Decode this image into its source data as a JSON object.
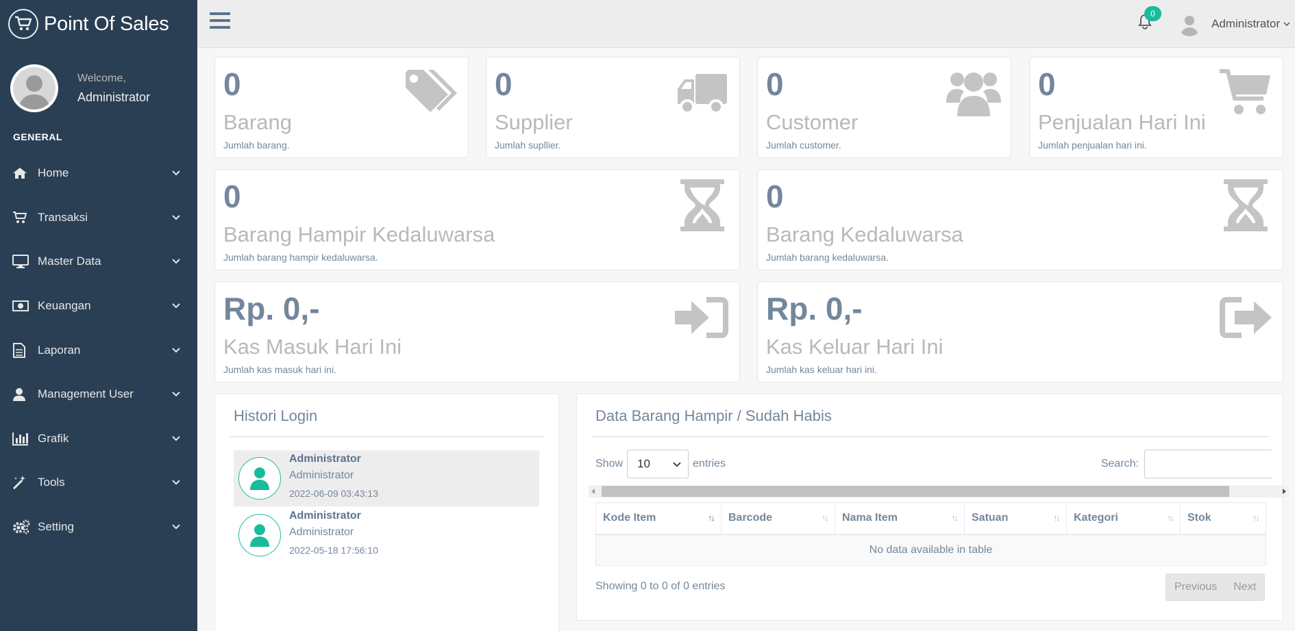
{
  "app": {
    "brand": "Point Of Sales"
  },
  "sidebar": {
    "welcome_label": "Welcome,",
    "user_name": "Administrator",
    "section": "GENERAL",
    "items": [
      {
        "label": "Home",
        "icon": "home-icon"
      },
      {
        "label": "Transaksi",
        "icon": "cart-icon"
      },
      {
        "label": "Master Data",
        "icon": "desktop-icon"
      },
      {
        "label": "Keuangan",
        "icon": "money-icon"
      },
      {
        "label": "Laporan",
        "icon": "file-icon"
      },
      {
        "label": "Management User",
        "icon": "user-icon"
      },
      {
        "label": "Grafik",
        "icon": "bar-chart-icon"
      },
      {
        "label": "Tools",
        "icon": "magic-wand-icon"
      },
      {
        "label": "Setting",
        "icon": "cogs-icon"
      }
    ]
  },
  "topbar": {
    "notif_count": "0",
    "user_name": "Administrator"
  },
  "stats": [
    {
      "count": "0",
      "label": "Barang",
      "desc": "Jumlah barang.",
      "icon": "tags-icon"
    },
    {
      "count": "0",
      "label": "Supplier",
      "desc": "Jumlah supllier.",
      "icon": "truck-icon"
    },
    {
      "count": "0",
      "label": "Customer",
      "desc": "Jumlah customer.",
      "icon": "users-icon"
    },
    {
      "count": "0",
      "label": "Penjualan Hari Ini",
      "desc": "Jumlah penjualan hari ini.",
      "icon": "cart-icon"
    },
    {
      "count": "0",
      "label": "Barang Hampir Kedaluwarsa",
      "desc": "Jumlah barang hampir kedaluwarsa.",
      "icon": "hourglass-icon"
    },
    {
      "count": "0",
      "label": "Barang Kedaluwarsa",
      "desc": "Jumlah barang kedaluwarsa.",
      "icon": "hourglass-icon"
    },
    {
      "count": "Rp. 0,-",
      "label": "Kas Masuk Hari Ini",
      "desc": "Jumlah kas masuk hari ini.",
      "icon": "sign-in-icon"
    },
    {
      "count": "Rp. 0,-",
      "label": "Kas Keluar Hari Ini",
      "desc": "Jumlah kas keluar hari ini.",
      "icon": "sign-out-icon"
    }
  ],
  "login_history": {
    "title": "Histori Login",
    "entries": [
      {
        "name": "Administrator",
        "role": "Administrator",
        "time": "2022-06-09 03:43:13"
      },
      {
        "name": "Administrator",
        "role": "Administrator",
        "time": "2022-05-18 17:56:10"
      }
    ]
  },
  "stock_table": {
    "title": "Data Barang Hampir / Sudah Habis",
    "show_label": "Show",
    "page_size": "10",
    "entries_label": "entries",
    "search_label": "Search:",
    "columns": [
      "Kode Item",
      "Barcode",
      "Nama Item",
      "Satuan",
      "Kategori",
      "Stok"
    ],
    "empty_text": "No data available in table",
    "info": "Showing 0 to 0 of 0 entries",
    "prev_label": "Previous",
    "next_label": "Next"
  },
  "colors": {
    "sidebar": "#2a3f54",
    "accent": "#1abb9c",
    "text": "#73879c"
  }
}
